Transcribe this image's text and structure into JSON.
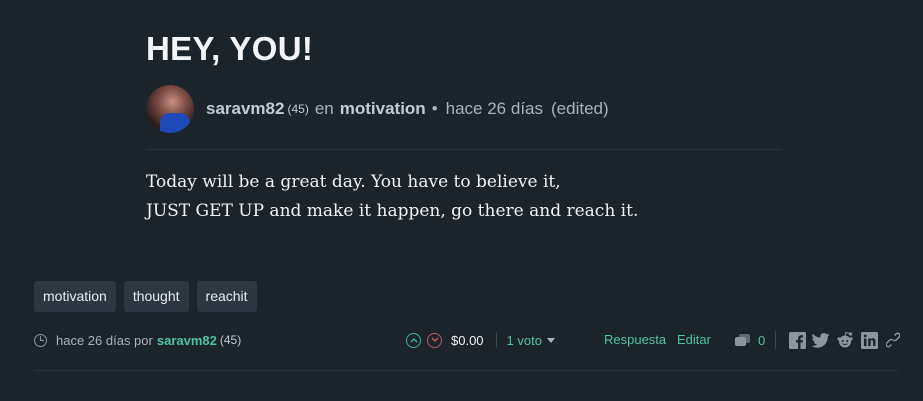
{
  "post": {
    "title": "HEY, YOU!",
    "author": "saravm82",
    "reputation": "(45)",
    "in_label": "en",
    "community": "motivation",
    "bullet": "•",
    "time_ago": "hace 26 días",
    "edited": "(edited)",
    "body_lines": [
      "Today will be a great day. You have to believe it,",
      "JUST GET UP and make it happen, go there and reach it."
    ]
  },
  "tags": [
    "motivation",
    "thought",
    "reachit"
  ],
  "footer": {
    "time_prefix": "hace 26 días por",
    "author": "saravm82",
    "reputation": "(45)",
    "payout": "$0.00",
    "votes_label": "1 voto",
    "reply_label": "Respuesta",
    "edit_label": "Editar",
    "comments_count": "0"
  },
  "colors": {
    "background": "#1b232b",
    "accent": "#4fc3a1",
    "downvote": "#c0595f",
    "tag_bg": "#2c3742"
  },
  "icons": [
    "clock-icon",
    "upvote-icon",
    "downvote-icon",
    "caret-down-icon",
    "comments-icon",
    "facebook-icon",
    "twitter-icon",
    "reddit-icon",
    "linkedin-icon",
    "link-icon"
  ]
}
